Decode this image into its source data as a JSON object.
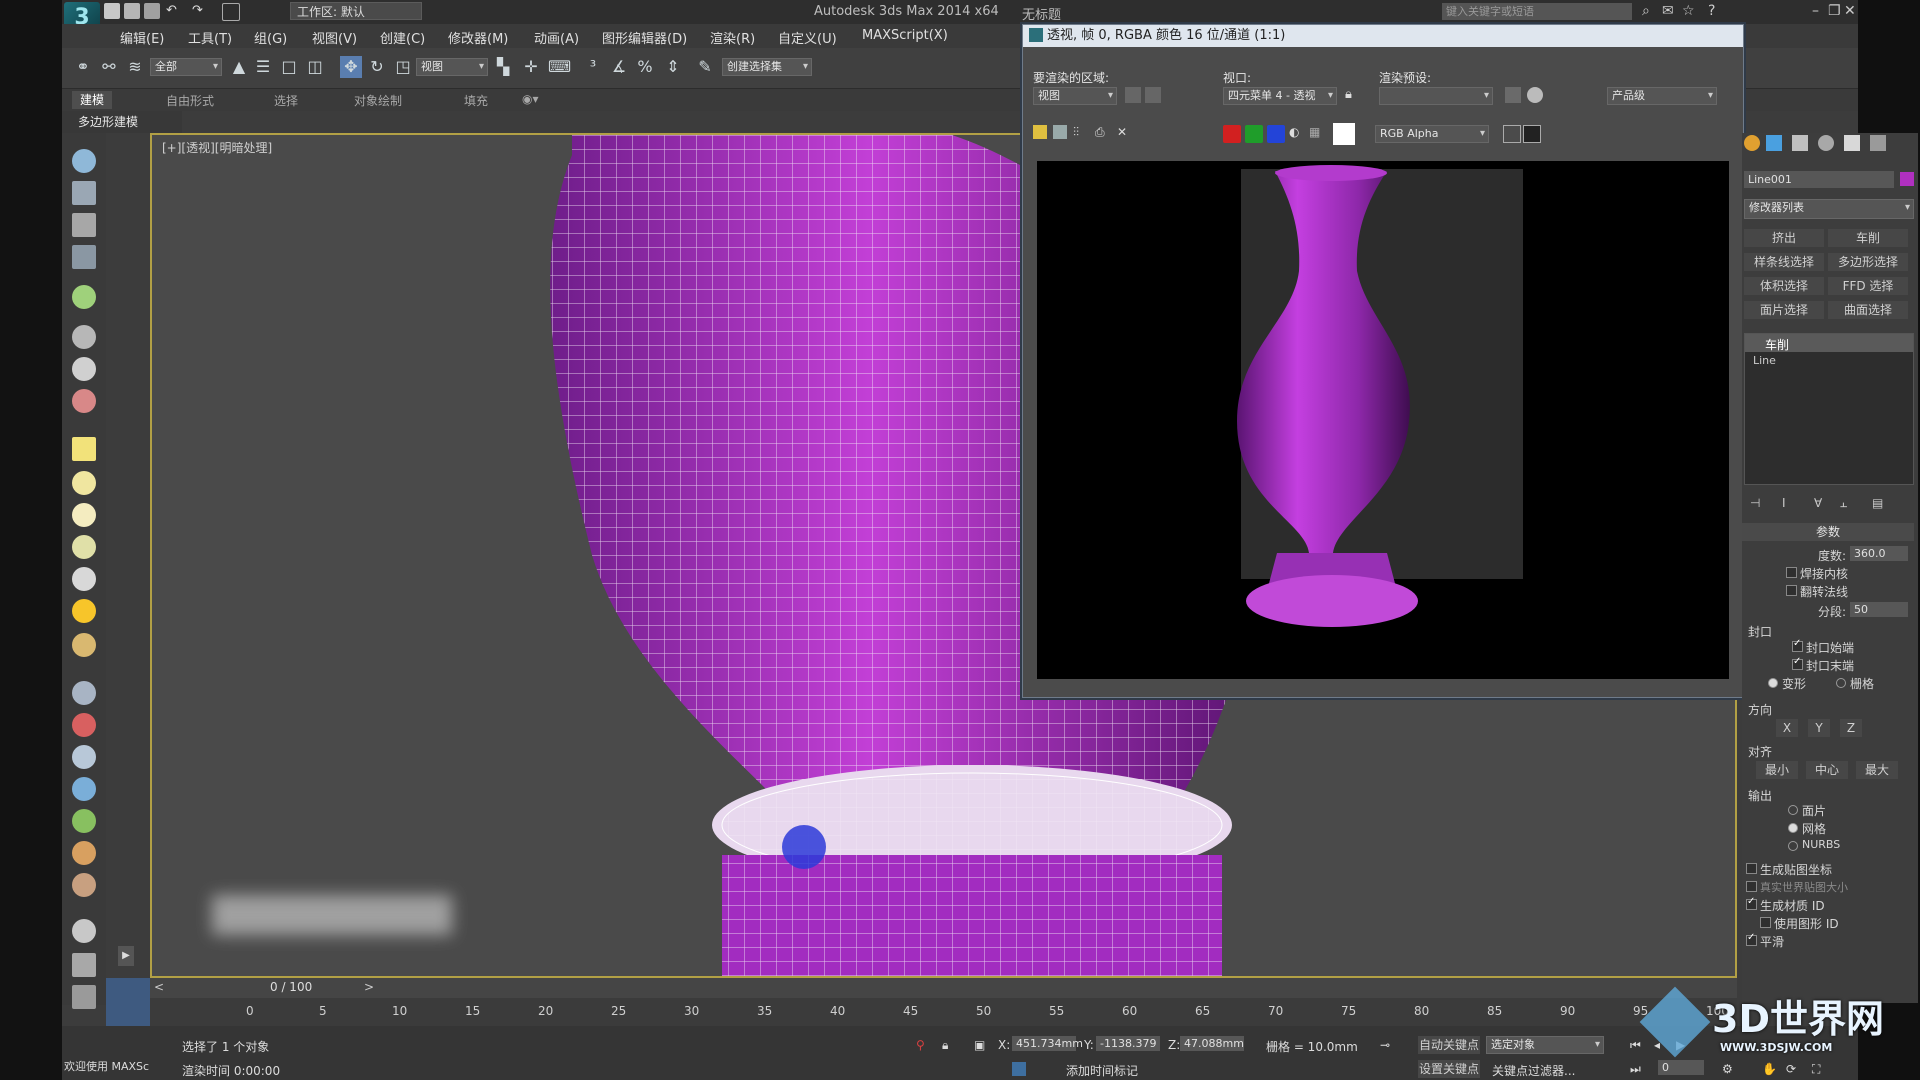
{
  "titlebar": {
    "workspace": "工作区: 默认",
    "app_title": "Autodesk 3ds Max  2014 x64",
    "file_name": "无标题",
    "search_placeholder": "键入关键字或短语"
  },
  "menu": [
    "编辑(E)",
    "工具(T)",
    "组(G)",
    "视图(V)",
    "创建(C)",
    "修改器(M)",
    "动画(A)",
    "图形编辑器(D)",
    "渲染(R)",
    "自定义(U)",
    "MAXScript(X)"
  ],
  "toolbar": {
    "selection_filter": "全部",
    "ref_coord": "视图",
    "named_selection": "创建选择集"
  },
  "ribbon": {
    "tabs": [
      "建模",
      "自由形式",
      "选择",
      "对象绘制",
      "填充"
    ],
    "subpanel": "多边形建模"
  },
  "viewport": {
    "label": "[+][透视][明暗处理]"
  },
  "render_window": {
    "title": "透视, 帧 0, RGBA 颜色 16 位/通道 (1:1)",
    "area_label": "要渲染的区域:",
    "area_value": "视图",
    "viewport_label": "视口:",
    "viewport_value": "四元菜单 4 - 透视",
    "preset_label": "渲染预设:",
    "preset_value": "",
    "quality_value": "产品级",
    "channel_value": "RGB Alpha",
    "colors": {
      "red": "#d22020",
      "green": "#1f9d2a",
      "blue": "#2344d8",
      "white": "#ffffff"
    }
  },
  "command_panel": {
    "object_name": "Line001",
    "object_color": "#b030c0",
    "modifier_list": "修改器列表",
    "buttons": [
      "挤出",
      "车削",
      "样条线选择",
      "多边形选择",
      "体积选择",
      "FFD 选择",
      "面片选择",
      "曲面选择"
    ],
    "stack": [
      "车削",
      "Line"
    ],
    "params_title": "参数",
    "degrees_label": "度数:",
    "degrees_value": "360.0",
    "weld_core": "焊接内核",
    "flip_normals": "翻转法线",
    "segments_label": "分段:",
    "segments_value": "50",
    "cap_title": "封口",
    "cap_start": "封口始端",
    "cap_end": "封口末端",
    "morph": "变形",
    "grid": "栅格",
    "direction_title": "方向",
    "dir_x": "X",
    "dir_y": "Y",
    "dir_z": "Z",
    "align_title": "对齐",
    "align_min": "最小",
    "align_center": "中心",
    "align_max": "最大",
    "output_title": "输出",
    "out_patch": "面片",
    "out_mesh": "网格",
    "out_nurbs": "NURBS",
    "gen_mapping": "生成贴图坐标",
    "real_world": "真实世界贴图大小",
    "gen_matid": "生成材质 ID",
    "use_shape_id": "使用图形 ID",
    "smooth": "平滑"
  },
  "timeline": {
    "frame_display": "0 / 100",
    "ticks": [
      "0",
      "5",
      "10",
      "15",
      "20",
      "25",
      "30",
      "35",
      "40",
      "45",
      "50",
      "55",
      "60",
      "65",
      "70",
      "75",
      "80",
      "85",
      "90",
      "95",
      "100"
    ]
  },
  "status": {
    "welcome": "欢迎使用 MAXSc",
    "selection": "选择了 1 个对象",
    "render_time": "渲染时间  0:00:00",
    "x_label": "X:",
    "x_value": "451.734mm",
    "y_label": "Y:",
    "y_value": "-1138.379",
    "z_label": "Z:",
    "z_value": "47.088mm",
    "grid": "栅格 = 10.0mm",
    "auto_key": "自动关键点",
    "selected": "选定对象",
    "set_key": "设置关键点",
    "key_filters": "关键点过滤器...",
    "add_time_tag": "添加时间标记",
    "frame_field": "0"
  },
  "watermark": "3D世界网",
  "watermark_url": "WWW.3DSJW.COM"
}
